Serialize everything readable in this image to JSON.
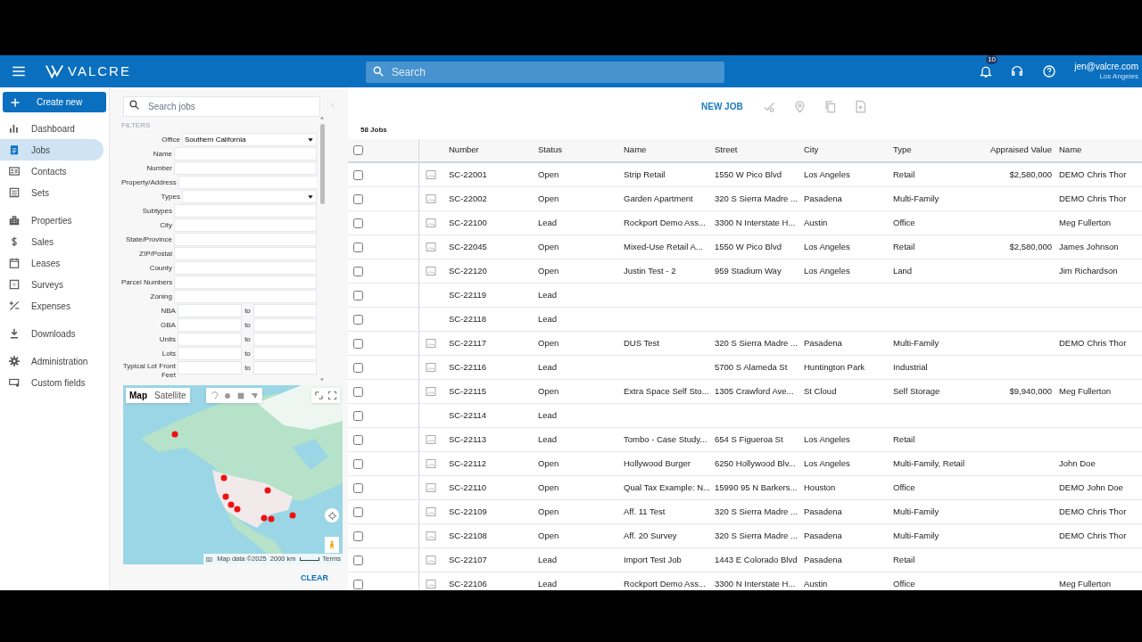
{
  "header": {
    "brand": "VALCRE",
    "search": {
      "placeholder": "Search"
    },
    "notifications": "10",
    "user": {
      "email": "jen@valcre.com",
      "office": "Los Angeles"
    }
  },
  "sidebar": {
    "create_button": "Create new",
    "items": [
      {
        "label": "Dashboard",
        "selected": false
      },
      {
        "label": "Jobs",
        "selected": true
      },
      {
        "label": "Contacts",
        "selected": false
      },
      {
        "label": "Sets",
        "selected": false
      },
      {
        "label": "Properties",
        "selected": false
      },
      {
        "label": "Sales",
        "selected": false
      },
      {
        "label": "Leases",
        "selected": false
      },
      {
        "label": "Surveys",
        "selected": false
      },
      {
        "label": "Expenses",
        "selected": false
      },
      {
        "label": "Downloads",
        "selected": false
      },
      {
        "label": "Administration",
        "selected": false
      },
      {
        "label": "Custom fields",
        "selected": false
      }
    ]
  },
  "filters": {
    "search": {
      "placeholder": "Search jobs"
    },
    "heading": "FILTERS",
    "fields": [
      {
        "label": "Office",
        "kind": "select",
        "value": "Southern California"
      },
      {
        "label": "Name",
        "kind": "text"
      },
      {
        "label": "Number",
        "kind": "text"
      },
      {
        "label": "Property/Address",
        "kind": "text"
      },
      {
        "label": "Types",
        "kind": "select"
      },
      {
        "label": "Subtypes",
        "kind": "text"
      },
      {
        "label": "City",
        "kind": "text"
      },
      {
        "label": "State/Province",
        "kind": "text"
      },
      {
        "label": "ZIP/Postal",
        "kind": "text"
      },
      {
        "label": "County",
        "kind": "text"
      },
      {
        "label": "Parcel Numbers",
        "kind": "text"
      },
      {
        "label": "Zoning",
        "kind": "text"
      },
      {
        "label": "NBA",
        "kind": "range",
        "to": "to"
      },
      {
        "label": "GBA",
        "kind": "range",
        "to": "to"
      },
      {
        "label": "Units",
        "kind": "range",
        "to": "to"
      },
      {
        "label": "Lots",
        "kind": "range",
        "to": "to"
      },
      {
        "label": "Typical Lot Front Feet",
        "kind": "range",
        "to": "to"
      }
    ],
    "map": {
      "tabs": [
        {
          "label": "Map",
          "selected": true
        },
        {
          "label": "Satellite",
          "selected": false
        }
      ],
      "attribution": "Map data ©2025",
      "scale": "2000 km",
      "terms": "Terms"
    },
    "clear_button": "CLEAR"
  },
  "toolbar": {
    "new_job": "NEW JOB",
    "count": "58 Jobs"
  },
  "table": {
    "all_selected": false,
    "columns": [
      "Number",
      "Status",
      "Name",
      "Street",
      "City",
      "Type",
      "Appraised Value",
      "Name"
    ],
    "rows": [
      {
        "selected": false,
        "has_image": true,
        "cells": [
          "SC-22001",
          "Open",
          "Strip Retail",
          "1550 W Pico Blvd",
          "Los Angeles",
          "Retail",
          "$2,580,000",
          "DEMO Chris Thor"
        ]
      },
      {
        "selected": false,
        "has_image": true,
        "cells": [
          "SC-22002",
          "Open",
          "Garden Apartment",
          "320 S Sierra Madre ...",
          "Pasadena",
          "Multi-Family",
          "",
          "DEMO Chris Thor"
        ]
      },
      {
        "selected": false,
        "has_image": true,
        "cells": [
          "SC-22100",
          "Lead",
          "Rockport Demo Ass...",
          "3300 N Interstate H...",
          "Austin",
          "Office",
          "",
          "Meg Fullerton"
        ]
      },
      {
        "selected": false,
        "has_image": true,
        "cells": [
          "SC-22045",
          "Open",
          "Mixed-Use Retail A...",
          "1550 W Pico Blvd",
          "Los Angeles",
          "Retail",
          "$2,580,000",
          "James Johnson"
        ]
      },
      {
        "selected": false,
        "has_image": true,
        "cells": [
          "SC-22120",
          "Open",
          "Justin Test - 2",
          "959 Stadium Way",
          "Los Angeles",
          "Land",
          "",
          "Jim Richardson"
        ]
      },
      {
        "selected": false,
        "has_image": false,
        "cells": [
          "SC-22119",
          "Lead",
          "",
          "",
          "",
          "",
          "",
          ""
        ]
      },
      {
        "selected": false,
        "has_image": false,
        "cells": [
          "SC-22118",
          "Lead",
          "",
          "",
          "",
          "",
          "",
          ""
        ]
      },
      {
        "selected": false,
        "has_image": true,
        "cells": [
          "SC-22117",
          "Open",
          "DUS Test",
          "320 S Sierra Madre ...",
          "Pasadena",
          "Multi-Family",
          "",
          "DEMO Chris Thor"
        ]
      },
      {
        "selected": false,
        "has_image": true,
        "cells": [
          "SC-22116",
          "Lead",
          "",
          "5700 S Alameda St",
          "Huntington Park",
          "Industrial",
          "",
          ""
        ]
      },
      {
        "selected": false,
        "has_image": true,
        "cells": [
          "SC-22115",
          "Open",
          "Extra Space Self Sto...",
          "1305 Crawford Ave...",
          "St Cloud",
          "Self Storage",
          "$9,940,000",
          "Meg Fullerton"
        ]
      },
      {
        "selected": false,
        "has_image": false,
        "cells": [
          "SC-22114",
          "Lead",
          "",
          "",
          "",
          "",
          "",
          ""
        ]
      },
      {
        "selected": false,
        "has_image": true,
        "cells": [
          "SC-22113",
          "Lead",
          "Tombo - Case Study...",
          "654 S Figueroa St",
          "Los Angeles",
          "Retail",
          "",
          ""
        ]
      },
      {
        "selected": false,
        "has_image": true,
        "cells": [
          "SC-22112",
          "Open",
          "Hollywood Burger",
          "6250 Hollywood Blv...",
          "Los Angeles",
          "Multi-Family, Retail",
          "",
          "John Doe"
        ]
      },
      {
        "selected": false,
        "has_image": true,
        "cells": [
          "SC-22110",
          "Open",
          "Qual Tax Example: N...",
          "15990 95 N Barkers...",
          "Houston",
          "Office",
          "",
          "DEMO John Doe"
        ]
      },
      {
        "selected": false,
        "has_image": true,
        "cells": [
          "SC-22109",
          "Open",
          "Aff. 11 Test",
          "320 S Sierra Madre ...",
          "Pasadena",
          "Multi-Family",
          "",
          "DEMO Chris Thor"
        ]
      },
      {
        "selected": false,
        "has_image": true,
        "cells": [
          "SC-22108",
          "Open",
          "Aff. 20 Survey",
          "320 S Sierra Madre ...",
          "Pasadena",
          "Multi-Family",
          "",
          "DEMO Chris Thor"
        ]
      },
      {
        "selected": false,
        "has_image": true,
        "cells": [
          "SC-22107",
          "Lead",
          "Import Test Job",
          "1443 E Colorado Blvd",
          "Pasadena",
          "Retail",
          "",
          ""
        ]
      },
      {
        "selected": false,
        "has_image": true,
        "cells": [
          "SC-22106",
          "Lead",
          "Rockport Demo Ass...",
          "3300 N Interstate H...",
          "Austin",
          "Office",
          "",
          "Meg Fullerton"
        ]
      }
    ]
  }
}
